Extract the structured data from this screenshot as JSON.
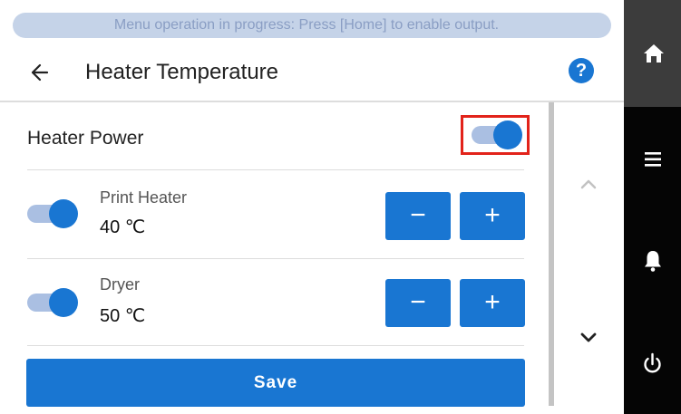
{
  "banner": {
    "text": "Menu operation in progress: Press [Home] to enable output."
  },
  "header": {
    "title": "Heater Temperature",
    "help_label": "?"
  },
  "heater_power": {
    "label": "Heater Power",
    "enabled": true
  },
  "heaters": [
    {
      "name": "Print Heater",
      "value": "40 ℃",
      "enabled": true,
      "minus_label": "−",
      "plus_label": "+"
    },
    {
      "name": "Dryer",
      "value": "50 ℃",
      "enabled": true,
      "minus_label": "−",
      "plus_label": "+"
    }
  ],
  "actions": {
    "save_label": "Save"
  },
  "side_nav": {
    "items": [
      "home-icon",
      "menu-icon",
      "bell-icon",
      "power-icon"
    ]
  },
  "colors": {
    "accent": "#1976d2",
    "toggle_track": "#aabfe2",
    "highlight": "#e2231a",
    "banner_bg": "#c5d3e8",
    "banner_text": "#8a9ec4",
    "side_nav_bg": "#050505",
    "side_nav_active": "#3c3c3c"
  }
}
